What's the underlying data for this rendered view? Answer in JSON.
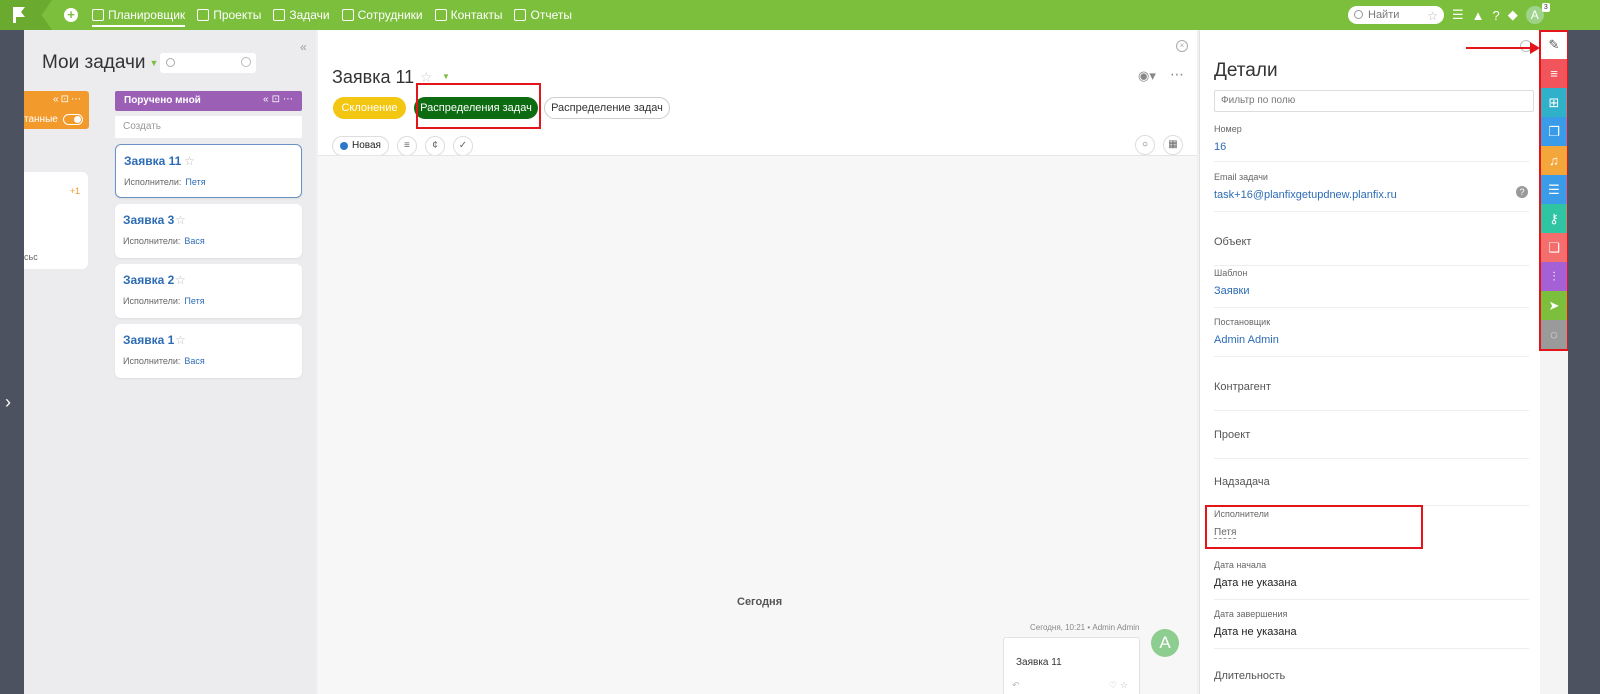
{
  "topbar": {
    "nav": [
      {
        "label": "Планировщик",
        "icon": "planner-icon",
        "active": true
      },
      {
        "label": "Проекты",
        "icon": "projects-icon"
      },
      {
        "label": "Задачи",
        "icon": "tasks-icon"
      },
      {
        "label": "Сотрудники",
        "icon": "employees-icon"
      },
      {
        "label": "Контакты",
        "icon": "contacts-icon"
      },
      {
        "label": "Отчеты",
        "icon": "reports-icon"
      }
    ],
    "search_placeholder": "Найти",
    "avatar_letter": "A",
    "avatar_badge": "3",
    "accent": "#7cbf3c"
  },
  "tasks": {
    "title": "Мои задачи",
    "orange_column_label": "танные",
    "orange_card_plus": "+1",
    "orange_card_text": "сьс",
    "column_title": "Поручено мной",
    "create_placeholder": "Создать",
    "executors_label": "Исполнители:",
    "cards": [
      {
        "name": "Заявка 11",
        "executor": "Петя",
        "selected": true
      },
      {
        "name": "Заявка 3",
        "executor": "Вася"
      },
      {
        "name": "Заявка 2",
        "executor": "Петя"
      },
      {
        "name": "Заявка 1",
        "executor": "Вася"
      }
    ]
  },
  "task": {
    "title": "Заявка 11",
    "pills": [
      "Склонение",
      "Распределения задач",
      "Распределение задач"
    ],
    "status": "Новая",
    "today": "Сегодня",
    "message_meta": "Сегодня, 10:21 • Admin Admin",
    "message_avatar": "A",
    "message_text": "Заявка 11"
  },
  "details": {
    "title": "Детали",
    "filter_placeholder": "Фильтр по полю",
    "number_label": "Номер",
    "number_value": "16",
    "email_label": "Email задачи",
    "email_value": "task+16@planfixgetupdnew.planfix.ru",
    "object_label": "Объект",
    "template_label": "Шаблон",
    "template_value": "Заявки",
    "author_label": "Постановщик",
    "author_value": "Admin Admin",
    "counterparty_label": "Контрагент",
    "project_label": "Проект",
    "parent_label": "Надзадача",
    "executors_label": "Исполнители",
    "executors_value": "Петя",
    "start_label": "Дата начала",
    "start_value": "Дата не указана",
    "end_label": "Дата завершения",
    "end_value": "Дата не указана",
    "duration_label": "Длительность"
  },
  "right_strip": [
    {
      "icon": "edit-icon",
      "color": "#ffffff"
    },
    {
      "icon": "list-icon",
      "color": "#f2545b"
    },
    {
      "icon": "org-icon",
      "color": "#2fb1c9"
    },
    {
      "icon": "files-icon",
      "color": "#3a9be8"
    },
    {
      "icon": "bell-icon",
      "color": "#f3a73b"
    },
    {
      "icon": "checklist-icon",
      "color": "#3a9be8"
    },
    {
      "icon": "key-icon",
      "color": "#2ec4a4"
    },
    {
      "icon": "book-icon",
      "color": "#f46e6e"
    },
    {
      "icon": "analytics-icon",
      "color": "#a660d6"
    },
    {
      "icon": "send-icon",
      "color": "#7cbf3c"
    },
    {
      "icon": "chat-icon",
      "color": "#9a9a9a"
    }
  ]
}
